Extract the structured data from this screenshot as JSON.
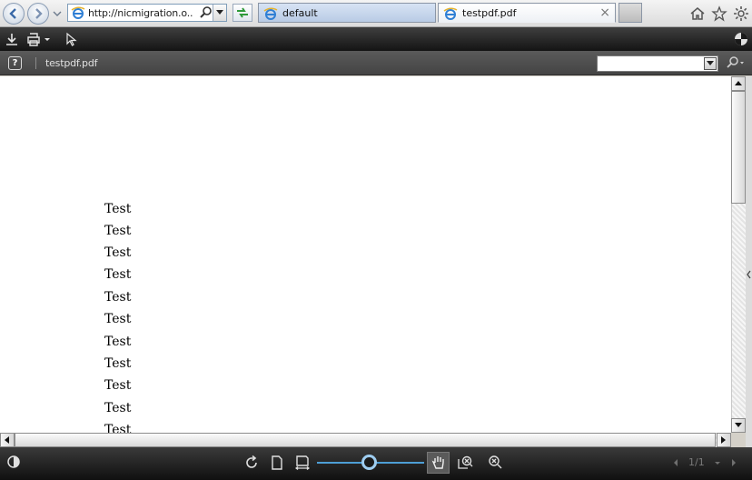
{
  "browser": {
    "address_url": "http://nicmigration.o...",
    "tabs": [
      {
        "label": "default",
        "active": false
      },
      {
        "label": "testpdf.pdf",
        "active": true
      }
    ],
    "tab_close_glyph": "×"
  },
  "viewer": {
    "document_title": "testpdf.pdf",
    "help_label": "?",
    "find_value": "",
    "page_indicator": "1/1",
    "zoom_level": 0.5
  },
  "document": {
    "lines": [
      "Test",
      "Test",
      "Test",
      "Test",
      "Test",
      "Test",
      "Test",
      "Test",
      "Test",
      "Test",
      "Test"
    ]
  },
  "icons": {
    "browser": [
      "back-arrow-icon",
      "forward-arrow-icon",
      "dropdown-icon",
      "ie-logo-icon",
      "search-icon",
      "refresh-icon",
      "home-icon",
      "favorites-star-icon",
      "settings-gear-icon"
    ],
    "viewer_top": [
      "download-icon",
      "print-icon",
      "select-arrow-icon",
      "viewer-logo-icon"
    ],
    "viewer_bottom": [
      "contrast-icon",
      "rotate-icon",
      "single-page-icon",
      "fit-width-icon",
      "hand-tool-icon",
      "zoom-region-icon",
      "zoom-out-icon",
      "previous-page-icon",
      "next-page-icon"
    ]
  },
  "colors": {
    "toolbar_dark": "#141414",
    "subbar": "#4e4e4e",
    "zoom_accent": "#4d9fd6",
    "active_tab": "#ffffff",
    "inactive_tab": "#c8d8ee"
  }
}
